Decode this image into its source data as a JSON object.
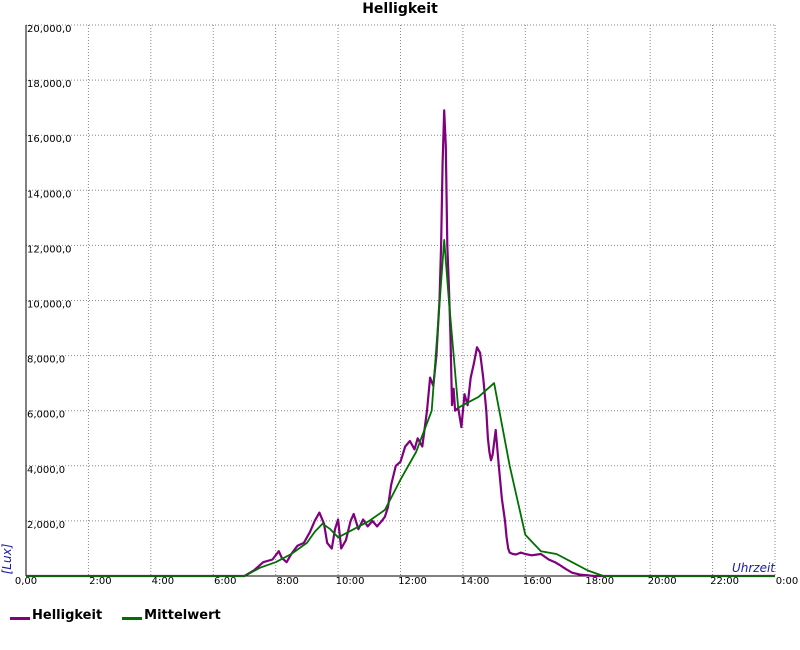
{
  "chart_data": {
    "type": "line",
    "title": "Helligkeit",
    "xlabel": "Uhrzeit",
    "ylabel": "[Lux]",
    "xlim": [
      0,
      24
    ],
    "ylim": [
      0,
      20000
    ],
    "x_ticks": [
      "0,00",
      "2:00",
      "4:00",
      "6:00",
      "8:00",
      "10:00",
      "12:00",
      "14:00",
      "16:00",
      "18:00",
      "20:00",
      "22:00",
      "0:00"
    ],
    "y_ticks": [
      "2,000,0",
      "4,000,0",
      "6,000,0",
      "8,000,0",
      "10,000,0",
      "12,000,0",
      "14,000,0",
      "16,000,0",
      "18,000,0",
      "20,000,0"
    ],
    "grid": true,
    "legend_position": "bottom-left",
    "series": [
      {
        "name": "Helligkeit",
        "color": "#800080",
        "x": [
          0,
          7.0,
          7.3,
          7.6,
          7.9,
          8.1,
          8.2,
          8.35,
          8.5,
          8.7,
          8.9,
          9.1,
          9.25,
          9.4,
          9.55,
          9.65,
          9.8,
          9.9,
          10.0,
          10.1,
          10.25,
          10.4,
          10.5,
          10.65,
          10.8,
          10.95,
          11.1,
          11.25,
          11.4,
          11.5,
          11.6,
          11.7,
          11.85,
          12.0,
          12.15,
          12.3,
          12.45,
          12.55,
          12.7,
          12.85,
          12.95,
          13.05,
          13.15,
          13.25,
          13.3,
          13.35,
          13.4,
          13.45,
          13.5,
          13.55,
          13.6,
          13.65,
          13.7,
          13.75,
          13.85,
          13.95,
          14.05,
          14.15,
          14.25,
          14.35,
          14.45,
          14.55,
          14.65,
          14.75,
          14.8,
          14.85,
          14.9,
          14.95,
          15.05,
          15.15,
          15.25,
          15.35,
          15.4,
          15.45,
          15.5,
          15.6,
          15.7,
          15.85,
          16.0,
          16.2,
          16.5,
          16.75,
          16.95,
          17.1,
          17.3,
          17.5,
          17.75,
          18.0,
          18.2,
          18.4,
          24
        ],
        "y": [
          0,
          0,
          200,
          500,
          600,
          900,
          650,
          500,
          800,
          1100,
          1200,
          1600,
          2000,
          2300,
          1900,
          1200,
          1000,
          1700,
          2050,
          1000,
          1300,
          2000,
          2250,
          1700,
          2050,
          1800,
          2000,
          1800,
          2000,
          2150,
          2500,
          3300,
          4000,
          4150,
          4700,
          4900,
          4600,
          5000,
          4700,
          6000,
          7200,
          6900,
          8000,
          10000,
          12000,
          15000,
          16900,
          15600,
          12000,
          10500,
          8800,
          6200,
          6800,
          6000,
          6100,
          5400,
          6600,
          6200,
          7200,
          7700,
          8300,
          8100,
          7200,
          6000,
          5000,
          4500,
          4200,
          4400,
          5300,
          4000,
          2800,
          2000,
          1400,
          1000,
          850,
          800,
          780,
          850,
          800,
          750,
          800,
          600,
          500,
          400,
          250,
          120,
          50,
          20,
          0,
          0,
          0
        ]
      },
      {
        "name": "Mittelwert",
        "color": "#007000",
        "x": [
          0,
          7.0,
          7.5,
          8.0,
          8.5,
          9.0,
          9.25,
          9.5,
          9.75,
          10.0,
          10.5,
          11.0,
          11.5,
          12.0,
          12.5,
          13.0,
          13.4,
          13.55,
          13.85,
          14.0,
          14.5,
          15.0,
          15.5,
          16.0,
          16.5,
          17.0,
          17.5,
          18.0,
          18.5,
          24
        ],
        "y": [
          0,
          0,
          300,
          500,
          800,
          1200,
          1600,
          1900,
          1700,
          1400,
          1700,
          2000,
          2400,
          3500,
          4500,
          6000,
          12200,
          10000,
          6100,
          6200,
          6500,
          7000,
          4000,
          1500,
          900,
          800,
          500,
          200,
          0,
          0
        ]
      }
    ]
  }
}
